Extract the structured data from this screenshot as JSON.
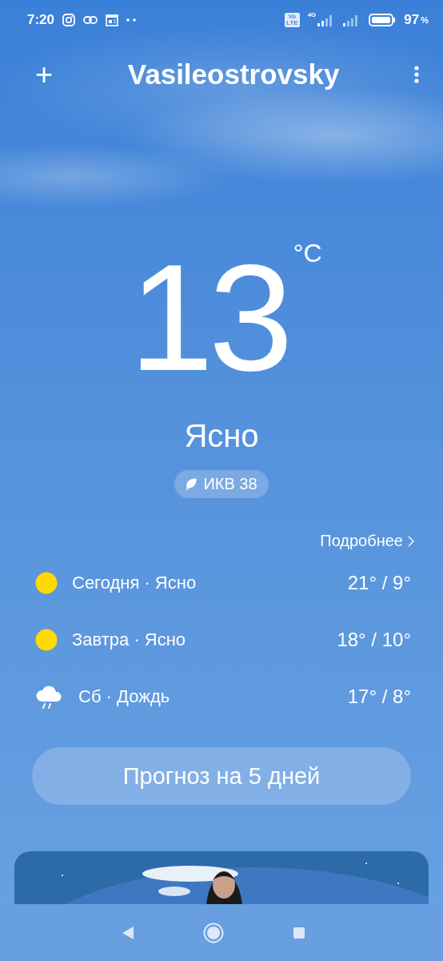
{
  "status_bar": {
    "time": "7:20",
    "volte": [
      "Vo",
      "LTE"
    ],
    "network": "4G",
    "battery": "97",
    "percent_sign": "%"
  },
  "header": {
    "add": "+",
    "city": "Vasileostrovsky"
  },
  "current": {
    "temperature": "13",
    "unit": "°C",
    "condition": "Ясно",
    "aqi": "ИКВ 38"
  },
  "more_link": "Подробнее",
  "forecast": [
    {
      "kind": "sun",
      "label": "Сегодня · Ясно",
      "temps": "21° / 9°"
    },
    {
      "kind": "sun",
      "label": "Завтра · Ясно",
      "temps": "18° / 10°"
    },
    {
      "kind": "rain",
      "label": "Сб · Дождь",
      "temps": "17° / 8°"
    }
  ],
  "forecast_button": "Прогноз на 5 дней"
}
